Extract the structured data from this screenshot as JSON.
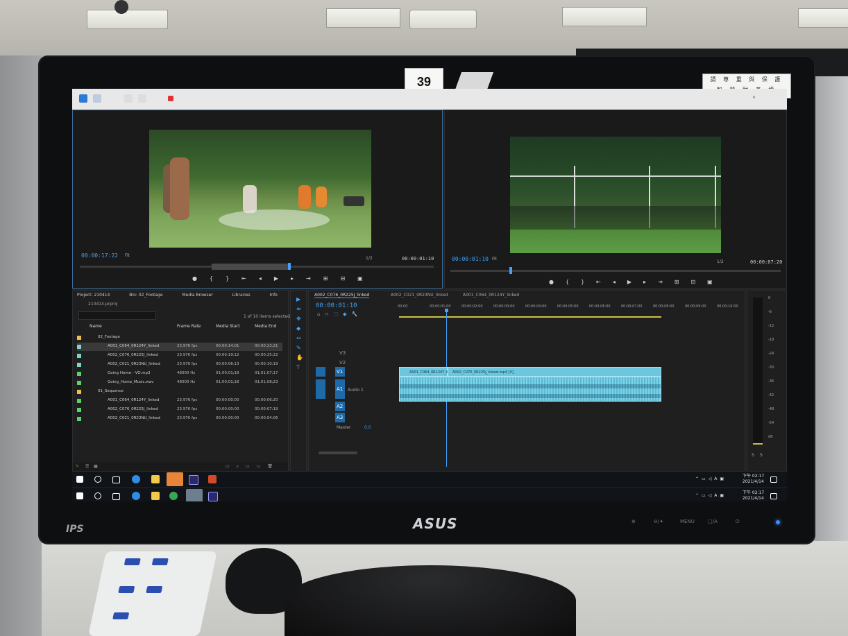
{
  "room": {
    "monitor_brand": "ASUS",
    "panel_type": "IPS",
    "sticker_number": "39",
    "sticker_text": [
      "請 尊 重 與 保 護",
      "智 慧 財 產 權"
    ],
    "bezel_buttons": [
      "⊕",
      "⊖/✦",
      "MENU",
      "□/A",
      "⏻"
    ]
  },
  "source_monitor": {
    "timecode": "00:00:17:22",
    "fit": "Fit",
    "scale": "1/2",
    "duration": "00:00:01:10"
  },
  "program_monitor": {
    "timecode": "00:00:01:10",
    "fit": "Fit",
    "scale": "1/2",
    "duration": "00:00:07:20"
  },
  "project_panel": {
    "tabs": [
      "Project: 210414",
      "Bin: 02_Footage",
      "Media Browser",
      "Libraries",
      "Info"
    ],
    "file": "210414.prproj",
    "selection": "1 of 10 items selected",
    "columns": [
      "Name",
      "Frame Rate",
      "Media Start",
      "Media End"
    ],
    "rows": [
      {
        "name": "02_Footage",
        "rate": "",
        "start": "",
        "end": "",
        "color": "#e8c04a"
      },
      {
        "name": "A001_C064_0R124Y_linked",
        "rate": "23.976 fps",
        "start": "00:00:14:01",
        "end": "00:00:23:21",
        "color": "#7fd3c6"
      },
      {
        "name": "A002_C076_0R225J_linked",
        "rate": "23.976 fps",
        "start": "00:00:19:12",
        "end": "00:00:25:22",
        "color": "#7fd3c6"
      },
      {
        "name": "A002_C021_0R23NU_linked",
        "rate": "23.976 fps",
        "start": "00:00:06:13",
        "end": "00:00:10:19",
        "color": "#7fd3c6"
      },
      {
        "name": "Going Home - VO.mp3",
        "rate": "48000 Hz",
        "start": "01;00;01;18",
        "end": "01;01;07;17",
        "color": "#58d16f"
      },
      {
        "name": "Going_Home_Music.wav",
        "rate": "48000 Hz",
        "start": "01;00;01;18",
        "end": "01;01;08;23",
        "color": "#58d16f"
      },
      {
        "name": "01_Sequence",
        "rate": "",
        "start": "",
        "end": "",
        "color": "#e8c04a"
      },
      {
        "name": "A001_C064_0R124Y_linked",
        "rate": "23.976 fps",
        "start": "00:00:00:00",
        "end": "00:00:06:20",
        "color": "#58d16f"
      },
      {
        "name": "A002_C076_0R225J_linked",
        "rate": "23.976 fps",
        "start": "00:00:00:00",
        "end": "00:00:07:19",
        "color": "#58d16f"
      },
      {
        "name": "A002_C021_0R23NU_linked",
        "rate": "23.976 fps",
        "start": "00:00:00:00",
        "end": "00:00:04:06",
        "color": "#58d16f"
      }
    ]
  },
  "timeline": {
    "tabs": [
      "A002_C076_0R225J_linked",
      "A002_C021_0R23NU_linked",
      "A001_C064_0R124Y_linked"
    ],
    "timecode": "00:00:01:10",
    "ruler": [
      "00:00",
      "00:00:01:00",
      "00:00:02:00",
      "00:00:03:00",
      "00:00:04:00",
      "00:00:05:00",
      "00:00:06:00",
      "00:00:07:00",
      "00:00:08:00",
      "00:00:09:00",
      "00:00:10:00"
    ],
    "tracks": [
      "V3",
      "V2",
      "V1",
      "A1",
      "A2",
      "A3"
    ],
    "audio_label": "Audio 1",
    "master": "Master",
    "master_value": "0.0",
    "clip1": "A001_C064_0R124Y_lin",
    "clip2": "A002_C076_0R225J_linked.mp4 [V]",
    "meter": [
      "0",
      "-6",
      "-12",
      "-18",
      "-24",
      "-30",
      "-36",
      "-42",
      "-48",
      "-54",
      "dB"
    ],
    "meter_bottom": [
      "S",
      "S"
    ]
  },
  "taskbar": {
    "time": "下午 02:17",
    "date": "2021/4/14"
  }
}
